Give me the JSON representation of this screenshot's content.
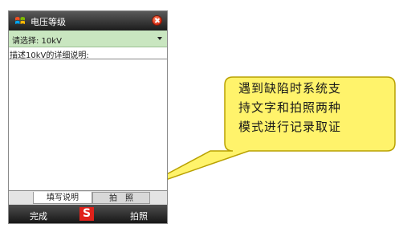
{
  "window": {
    "title": "电压等级"
  },
  "select": {
    "value": "请选择: 10kV"
  },
  "description": {
    "label": "描述10kV的详细说明:",
    "value": ""
  },
  "tabs": [
    {
      "label": "填写说明"
    },
    {
      "label": "拍　照"
    }
  ],
  "softkeys": {
    "left": "完成",
    "right": "拍照",
    "ime_letter": "S"
  },
  "callout": {
    "lines": [
      "遇到缺陷时系统支",
      "持文字和拍照两种",
      "模式进行记录取证"
    ],
    "fill": "#fff36b",
    "stroke": "#b9a100"
  },
  "colors": {
    "select_bg": "#c9e6c0",
    "ime": "#e0221b"
  }
}
